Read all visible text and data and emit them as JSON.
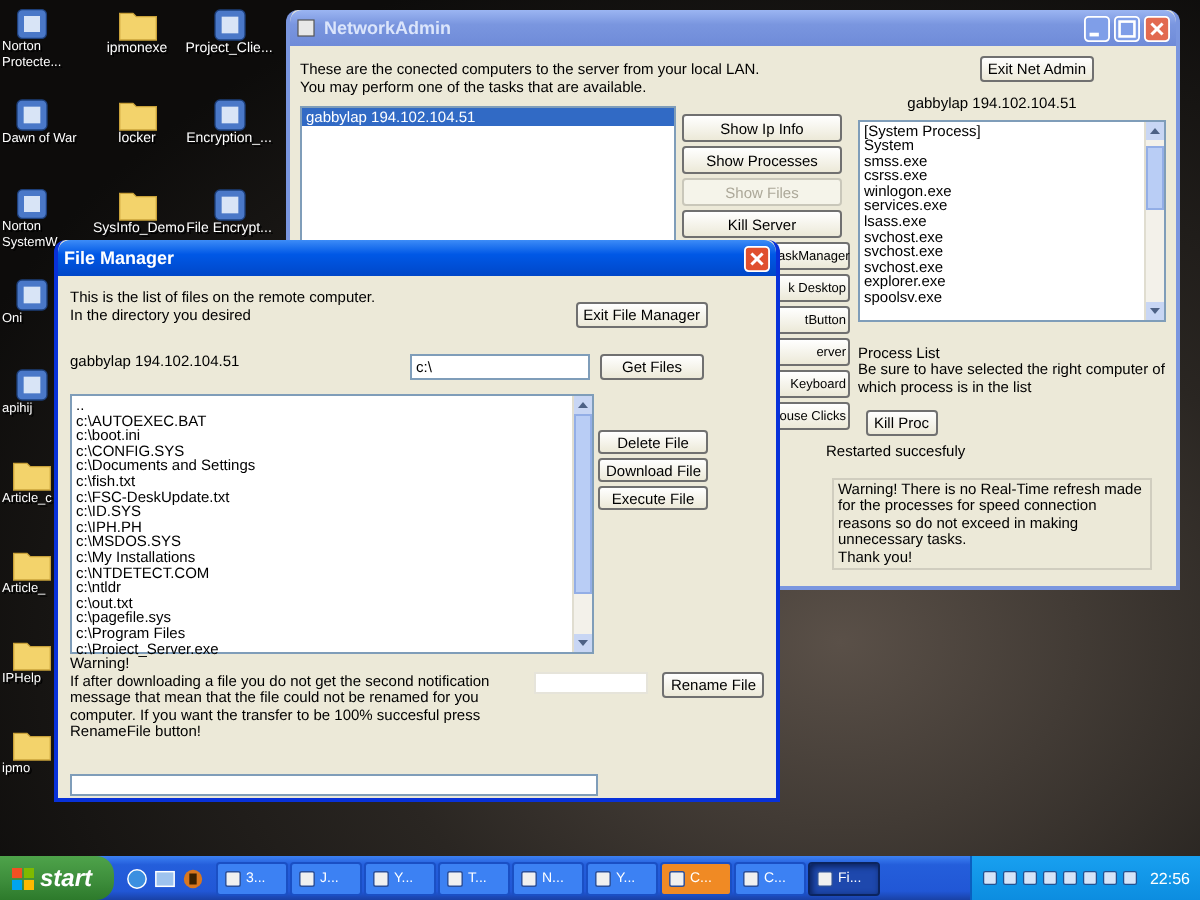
{
  "desktop_columns": [
    [
      {
        "label": "Norton Protecte...",
        "kind": "app"
      },
      {
        "label": "Dawn of War",
        "kind": "app"
      },
      {
        "label": "Norton SystemW",
        "kind": "app"
      },
      {
        "label": "Oni",
        "kind": "app"
      },
      {
        "label": "apihij",
        "kind": "app"
      },
      {
        "label": "Article_c",
        "kind": "folder"
      },
      {
        "label": "Article_",
        "kind": "folder"
      },
      {
        "label": "IPHelp",
        "kind": "folder"
      },
      {
        "label": "ipmo",
        "kind": "folder"
      }
    ],
    [
      {
        "label": "ipmonexe",
        "kind": "folder"
      },
      {
        "label": "locker",
        "kind": "folder"
      },
      {
        "label": "SysInfo_Demo",
        "kind": "folder"
      }
    ],
    [
      {
        "label": "Project_Clie...",
        "kind": "app"
      },
      {
        "label": "Encryption_...",
        "kind": "app"
      },
      {
        "label": "File Encrypt...",
        "kind": "app"
      }
    ]
  ],
  "network_admin": {
    "title": "NetworkAdmin",
    "intro": "These are the conected computers to the server from your local LAN.\nYou may perform one of the tasks that are available.",
    "computers": [
      {
        "label": "gabbylap 194.102.104.51",
        "selected": true
      }
    ],
    "buttons": [
      {
        "label": "Show Ip Info",
        "disabled": false
      },
      {
        "label": "Show Processes",
        "disabled": false
      },
      {
        "label": "Show Files",
        "disabled": true
      },
      {
        "label": "Kill Server",
        "disabled": false
      },
      {
        "label": "askManager",
        "disabled": false
      },
      {
        "label": "k Desktop",
        "disabled": false
      },
      {
        "label": "tButton",
        "disabled": false
      },
      {
        "label": "erver",
        "disabled": false
      },
      {
        "label": "Keyboard",
        "disabled": false
      },
      {
        "label": "ouse Clicks",
        "disabled": false
      }
    ],
    "exit_button": "Exit Net Admin",
    "computer_label": "gabbylap 194.102.104.51",
    "processes": [
      "[System Process]",
      "System",
      "smss.exe",
      "csrss.exe",
      "winlogon.exe",
      "services.exe",
      "lsass.exe",
      "svchost.exe",
      "svchost.exe",
      "svchost.exe",
      "explorer.exe",
      "spoolsv.exe"
    ],
    "process_note": "Process List\nBe sure to have selected the right computer of which process is in the list",
    "kill_button": "Kill Proc",
    "status": "Restarted succesfuly",
    "warning": "Warning! There is no Real-Time refresh made for the processes for speed connection reasons so do not exceed in making unnecessary tasks.\nThank you!"
  },
  "file_manager": {
    "title": "File Manager",
    "intro": "This is the list of files on the remote computer.\nIn the directory you desired",
    "exit_button": "Exit File Manager",
    "computer_label": "gabbylap 194.102.104.51",
    "path": "c:\\",
    "get_button": "Get Files",
    "files": [
      "..",
      "c:\\AUTOEXEC.BAT",
      "c:\\boot.ini",
      "c:\\CONFIG.SYS",
      "c:\\Documents and Settings",
      "c:\\fish.txt",
      "c:\\FSC-DeskUpdate.txt",
      "c:\\ID.SYS",
      "c:\\IPH.PH",
      "c:\\MSDOS.SYS",
      "c:\\My Installations",
      "c:\\NTDETECT.COM",
      "c:\\ntldr",
      "c:\\out.txt",
      "c:\\pagefile.sys",
      "c:\\Program Files",
      "c:\\Proiect_Server.exe"
    ],
    "actions": [
      "Delete File",
      "Download File",
      "Execute File"
    ],
    "warning": "Warning!\nIf after downloading a file  you do not get the second notification message that mean that the file could not be renamed for you computer. If you want the transfer to be 100% succesful press RenameFile button!",
    "rename_button": "Rename File"
  },
  "taskbar": {
    "start": "start",
    "tasks": [
      {
        "label": "3...",
        "selected": false,
        "attention": false
      },
      {
        "label": "J...",
        "selected": false,
        "attention": false
      },
      {
        "label": "Y...",
        "selected": false,
        "attention": false
      },
      {
        "label": "T...",
        "selected": false,
        "attention": false
      },
      {
        "label": "N...",
        "selected": false,
        "attention": false
      },
      {
        "label": "Y...",
        "selected": false,
        "attention": false
      },
      {
        "label": "C...",
        "selected": false,
        "attention": true
      },
      {
        "label": "C...",
        "selected": false,
        "attention": false
      },
      {
        "label": "Fi...",
        "selected": true,
        "attention": false
      }
    ],
    "clock": "22:56"
  }
}
